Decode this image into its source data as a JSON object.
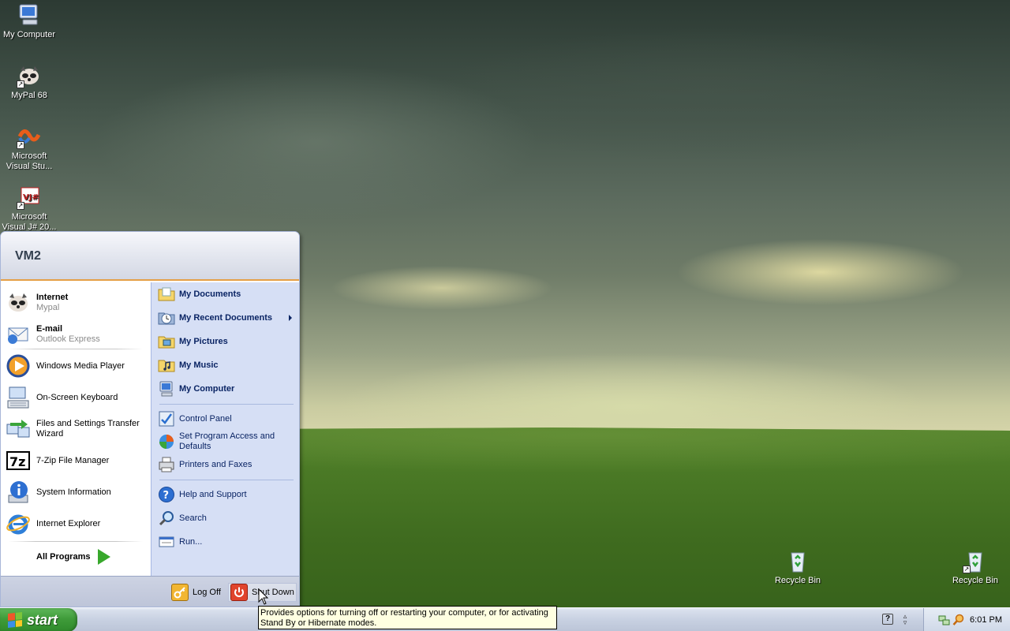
{
  "desktop": {
    "icons": [
      {
        "label": "My Computer",
        "icon": "my-computer-icon"
      },
      {
        "label": "MyPal 68",
        "icon": "mypal-raccoon-icon"
      },
      {
        "label": "Microsoft Visual Stu...",
        "icon": "visual-studio-icon"
      },
      {
        "label": "Microsoft Visual J# 20...",
        "icon": "visual-jsharp-icon"
      },
      {
        "label": "Recycle Bin",
        "icon": "recycle-bin-icon"
      },
      {
        "label": "Recycle Bin",
        "icon": "recycle-bin-icon"
      }
    ]
  },
  "start_menu": {
    "user_name": "VM2",
    "pinned": [
      {
        "title": "Internet",
        "subtitle": "Mypal",
        "icon": "mypal-raccoon-icon"
      },
      {
        "title": "E-mail",
        "subtitle": "Outlook Express",
        "icon": "outlook-express-icon"
      }
    ],
    "recent": [
      {
        "label": "Windows Media Player",
        "icon": "media-player-icon"
      },
      {
        "label": "On-Screen Keyboard",
        "icon": "keyboard-icon"
      },
      {
        "label": "Files and Settings Transfer Wizard",
        "icon": "transfer-wizard-icon"
      },
      {
        "label": "7-Zip File Manager",
        "icon": "7zip-icon"
      },
      {
        "label": "System Information",
        "icon": "info-icon"
      },
      {
        "label": "Internet Explorer",
        "icon": "internet-explorer-icon"
      }
    ],
    "all_programs": "All Programs",
    "places": [
      {
        "label": "My Documents",
        "icon": "folder-documents-icon"
      },
      {
        "label": "My Recent Documents",
        "icon": "recent-documents-icon"
      },
      {
        "label": "My Pictures",
        "icon": "folder-pictures-icon"
      },
      {
        "label": "My Music",
        "icon": "folder-music-icon"
      },
      {
        "label": "My Computer",
        "icon": "my-computer-icon"
      }
    ],
    "settings": [
      {
        "label": "Control Panel",
        "icon": "control-panel-icon"
      },
      {
        "label": "Set Program Access and Defaults",
        "icon": "program-defaults-icon"
      },
      {
        "label": "Printers and Faxes",
        "icon": "printer-icon"
      }
    ],
    "tools": [
      {
        "label": "Help and Support",
        "icon": "help-icon"
      },
      {
        "label": "Search",
        "icon": "search-icon"
      },
      {
        "label": "Run...",
        "icon": "run-icon"
      }
    ],
    "footer": {
      "log_off": "Log Off",
      "shut_down": "Shut Down"
    }
  },
  "tooltip": {
    "text": "Provides options for turning off or restarting your computer, or for activating Stand By or Hibernate modes."
  },
  "taskbar": {
    "start_label": "start",
    "clock": "6:01 PM",
    "help_glyph": "?"
  },
  "colors": {
    "start_green": "#3f9b3a",
    "menu_header_accent": "#e59f46",
    "right_pane": "#d6dff5",
    "tooltip_bg": "#ffffe1"
  }
}
